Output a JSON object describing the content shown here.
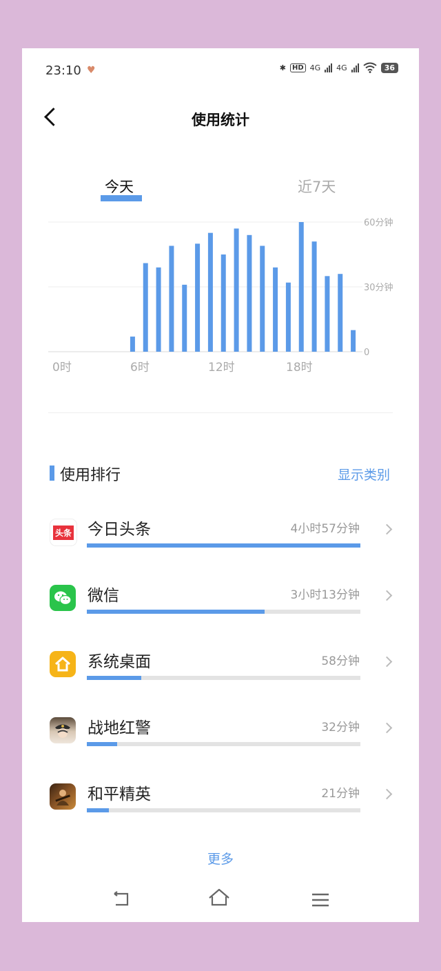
{
  "status_bar": {
    "time": "23:10",
    "hd_label": "HD",
    "network_1": "4G",
    "network_2": "4G",
    "battery": "36"
  },
  "header": {
    "title": "使用统计"
  },
  "tabs": [
    {
      "label": "今天",
      "active": true
    },
    {
      "label": "近7天",
      "active": false
    }
  ],
  "chart_data": {
    "type": "bar",
    "x": [
      0,
      1,
      2,
      3,
      4,
      5,
      6,
      7,
      8,
      9,
      10,
      11,
      12,
      13,
      14,
      15,
      16,
      17,
      18,
      19,
      20,
      21,
      22,
      23
    ],
    "values": [
      0,
      0,
      0,
      0,
      0,
      0,
      7,
      41,
      39,
      49,
      31,
      50,
      55,
      45,
      57,
      54,
      49,
      39,
      32,
      60,
      51,
      35,
      36,
      10
    ],
    "x_tick_labels": [
      "0时",
      "6时",
      "12时",
      "18时"
    ],
    "x_tick_positions": [
      0,
      6,
      12,
      18
    ],
    "y_tick_labels": [
      "60分钟",
      "30分钟",
      "0"
    ],
    "y_tick_values": [
      60,
      30,
      0
    ],
    "ylim": [
      0,
      60
    ],
    "grid": true,
    "color": "#5b9ae8"
  },
  "ranking": {
    "title": "使用排行",
    "show_category": "显示类别",
    "apps": [
      {
        "name": "今日头条",
        "duration": "4小时57分钟",
        "share": 1.0,
        "icon": "toutiao-icon",
        "icon_text": "头条"
      },
      {
        "name": "微信",
        "duration": "3小时13分钟",
        "share": 0.65,
        "icon": "wechat-icon"
      },
      {
        "name": "系统桌面",
        "duration": "58分钟",
        "share": 0.2,
        "icon": "launcher-icon"
      },
      {
        "name": "战地红警",
        "duration": "32分钟",
        "share": 0.11,
        "icon": "game-red-alert-icon"
      },
      {
        "name": "和平精英",
        "duration": "21分钟",
        "share": 0.08,
        "icon": "game-peace-elite-icon"
      }
    ],
    "more": "更多"
  },
  "colors": {
    "accent": "#5b9ae8",
    "track": "#e3e3e3",
    "toutiao": "#e8323c",
    "wechat": "#2ac44b",
    "launcher": "#f6b418"
  }
}
